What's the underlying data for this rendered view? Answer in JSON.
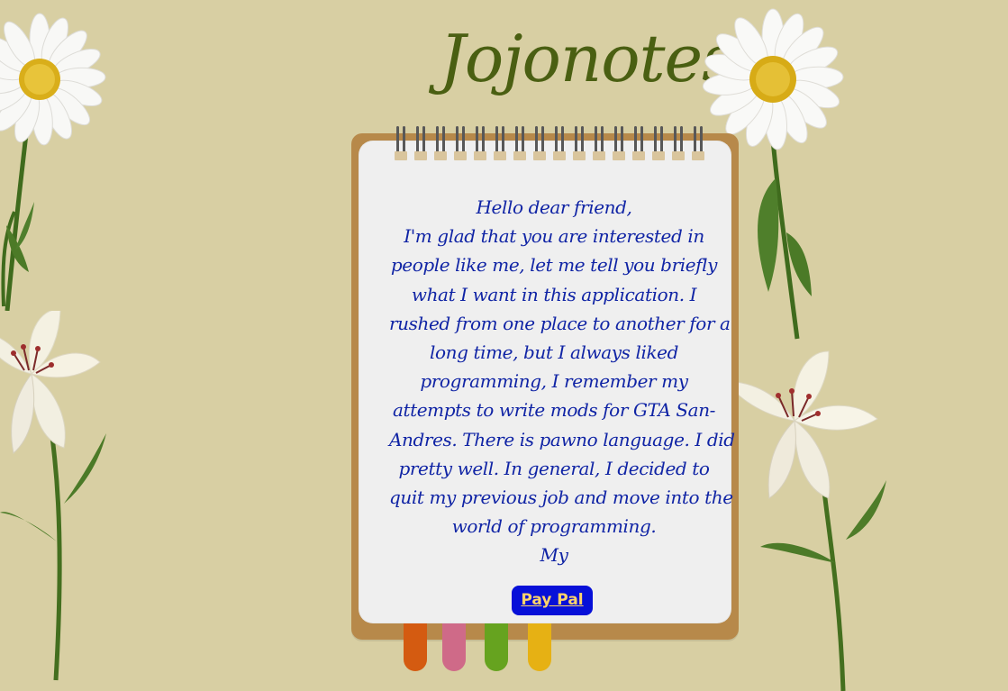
{
  "title": "Jojonotes",
  "letter": {
    "lines": [
      "Hello dear friend,",
      "I'm glad that you are interested in",
      "people like me, let me tell you briefly",
      "what I want in this application. I",
      "rushed from one place to another for a",
      "long time, but I always liked",
      "programming, I remember my",
      "attempts to write mods for GTA San-",
      "Andres. There is pawno language. I did",
      "pretty well. In general, I decided to",
      "quit my previous job and move into the",
      "world of programming.",
      "My"
    ]
  },
  "button": {
    "label": "Pay Pal"
  },
  "colors": {
    "background": "#d8cfa3",
    "title": "#4a5f12",
    "text": "#1024a5",
    "button": "#0710d8",
    "button_text": "#ffd46b"
  },
  "icons": [
    "daisy-icon",
    "lily-icon",
    "spiral-binding-icon"
  ]
}
